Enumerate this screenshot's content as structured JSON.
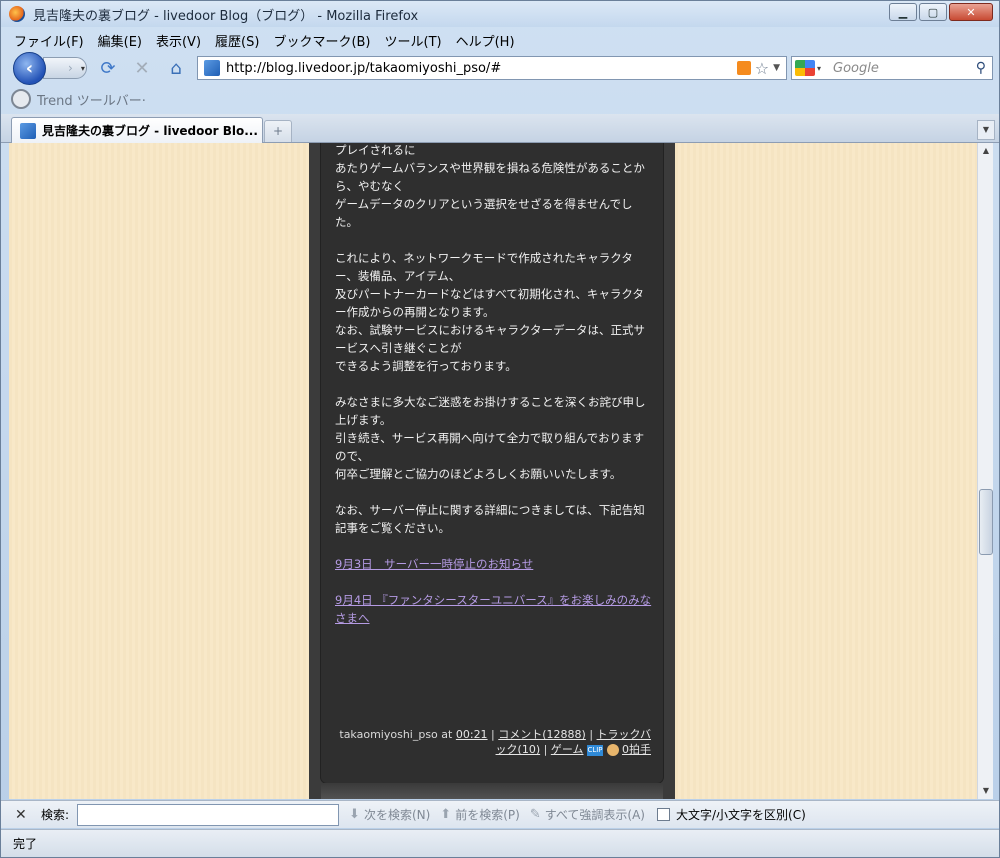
{
  "window": {
    "title": "見吉隆夫の裏ブログ - livedoor Blog（ブログ） - Mozilla Firefox"
  },
  "menu": [
    "ファイル(F)",
    "編集(E)",
    "表示(V)",
    "履歴(S)",
    "ブックマーク(B)",
    "ツール(T)",
    "ヘルプ(H)"
  ],
  "nav": {
    "url": "http://blog.livedoor.jp/takaomiyoshi_pso/#",
    "search_placeholder": "Google"
  },
  "trend_toolbar": {
    "label": "Trend ツールバー·"
  },
  "tabs": [
    {
      "label": "見吉隆夫の裏ブログ - livedoor Blo..."
    }
  ],
  "post": {
    "paragraphs": [
      "プレイされるに\nあたりゲームバランスや世界観を損ねる危険性があることから、やむなく\nゲームデータのクリアという選択をせざるを得ませんでした。",
      "これにより、ネットワークモードで作成されたキャラクター、装備品、アイテム、\n及びパートナーカードなどはすべて初期化され、キャラクター作成からの再開となります。\nなお、試験サービスにおけるキャラクターデータは、正式サービスへ引き継ぐことが\nできるよう調整を行っております。",
      "みなさまに多大なご迷惑をお掛けすることを深くお詫び申し上げます。\n引き続き、サービス再開へ向けて全力で取り組んでおりますので、\n何卒ご理解とご協力のほどよろしくお願いいたします。",
      "なお、サーバー停止に関する詳細につきましては、下記告知記事をご覧ください。"
    ],
    "links": [
      "9月3日　サーバー一時停止のお知らせ",
      "9月4日 『ファンタシースターユニバース』をお楽しみのみなさまへ"
    ],
    "footer": {
      "author": "takaomiyoshi_pso",
      "at": "at",
      "time": "00:21",
      "comments": "コメント(12888)",
      "trackback": "トラックバック(10)",
      "category": "ゲーム",
      "clip": "CLIP",
      "hakushu": "0拍手"
    }
  },
  "findbar": {
    "label": "検索:",
    "next": "次を検索(N)",
    "prev": "前を検索(P)",
    "highlight": "すべて強調表示(A)",
    "match_case": "大文字/小文字を区別(C)"
  },
  "status": {
    "text": "完了"
  }
}
